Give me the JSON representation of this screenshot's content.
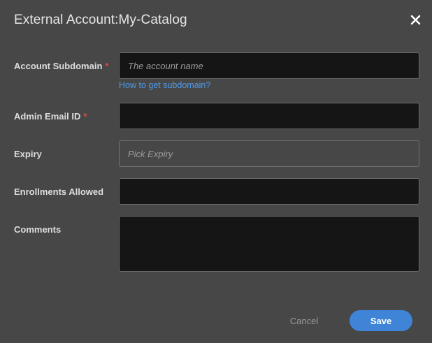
{
  "dialog": {
    "title": "External Account:My-Catalog",
    "close_icon": "close-icon"
  },
  "form": {
    "subdomain": {
      "label": "Account Subdomain",
      "required_mark": "*",
      "placeholder": "The account name",
      "value": "",
      "help_link": "How to get subdomain?"
    },
    "admin_email": {
      "label": "Admin Email ID",
      "required_mark": "*",
      "value": ""
    },
    "expiry": {
      "label": "Expiry",
      "placeholder": "Pick Expiry",
      "value": ""
    },
    "enrollments": {
      "label": "Enrollments Allowed",
      "value": ""
    },
    "comments": {
      "label": "Comments",
      "value": ""
    }
  },
  "actions": {
    "cancel_label": "Cancel",
    "save_label": "Save"
  },
  "colors": {
    "background": "#474747",
    "input_background": "#151515",
    "accent": "#3f84d6",
    "link": "#4f9be8",
    "required": "#e04848"
  }
}
